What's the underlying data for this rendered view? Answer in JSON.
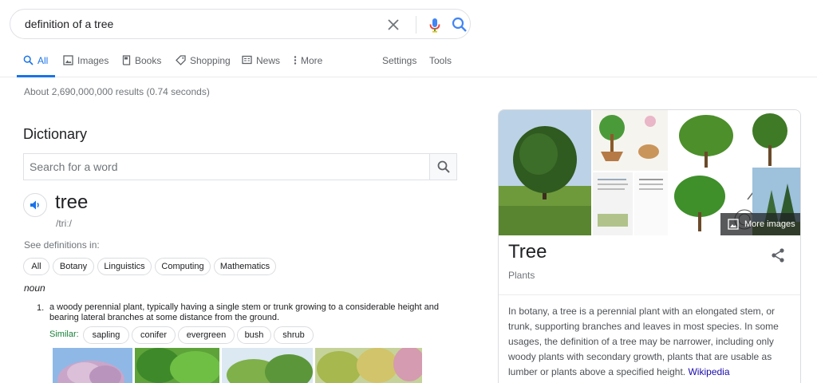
{
  "search": {
    "query": "definition of a tree"
  },
  "tabs": [
    {
      "label": "All",
      "icon": "search-icon"
    },
    {
      "label": "Images",
      "icon": "image-icon"
    },
    {
      "label": "Books",
      "icon": "book-icon"
    },
    {
      "label": "Shopping",
      "icon": "tag-icon"
    },
    {
      "label": "News",
      "icon": "news-icon"
    },
    {
      "label": "More",
      "icon": "more-vert-icon"
    },
    {
      "label": "Settings"
    },
    {
      "label": "Tools"
    }
  ],
  "results_count": "About 2,690,000,000 results (0.74 seconds)",
  "dictionary": {
    "title": "Dictionary",
    "search_placeholder": "Search for a word",
    "word": "tree",
    "phonetic": "/triː/",
    "see_definitions": "See definitions in:",
    "categories": [
      "All",
      "Botany",
      "Linguistics",
      "Computing",
      "Mathematics"
    ],
    "part_of_speech": "noun",
    "definition_number": "1.",
    "definition": "a woody perennial plant, typically having a single stem or trunk growing to a considerable height and bearing lateral branches at some distance from the ground.",
    "similar_label": "Similar:",
    "similar": [
      "sapling",
      "conifer",
      "evergreen",
      "bush",
      "shrub"
    ]
  },
  "knowledge_panel": {
    "more_images": "More images",
    "title": "Tree",
    "subtitle": "Plants",
    "description": "In botany, a tree is a perennial plant with an elongated stem, or trunk, supporting branches and leaves in most species. In some usages, the definition of a tree may be narrower, including only woody plants with secondary growth, plants that are usable as lumber or plants above a specified height.",
    "source": "Wikipedia"
  },
  "colors": {
    "accent": "#1a73e8",
    "link": "#1a0dab",
    "similar": "#188038"
  }
}
